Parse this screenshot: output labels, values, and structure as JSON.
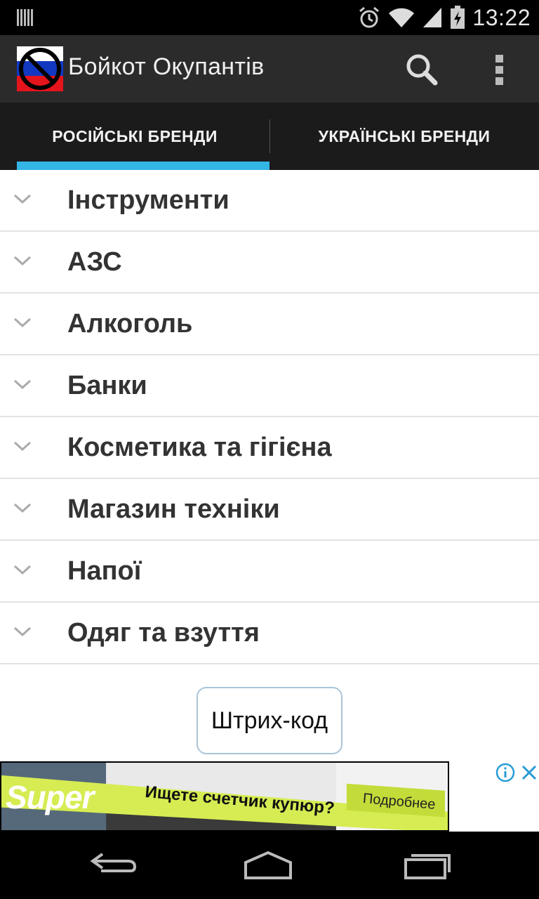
{
  "status_bar": {
    "time": "13:22",
    "icons": [
      "barcode-notification-icon",
      "alarm-icon",
      "wifi-icon",
      "signal-icon",
      "battery-charging-icon"
    ]
  },
  "action_bar": {
    "title": "Бойкот Окупантів",
    "logo": "ru-flag-prohibited-logo",
    "actions": [
      "search-icon",
      "overflow-menu-icon"
    ]
  },
  "tabs": [
    {
      "label": "РОСІЙСЬКІ БРЕНДИ",
      "selected": true
    },
    {
      "label": "УКРАЇНСЬКІ БРЕНДИ",
      "selected": false
    }
  ],
  "categories": [
    {
      "label": "Інструменти"
    },
    {
      "label": "АЗС"
    },
    {
      "label": "Алкоголь"
    },
    {
      "label": "Банки"
    },
    {
      "label": "Косметика та гігієна"
    },
    {
      "label": "Магазин техніки"
    },
    {
      "label": "Напої"
    },
    {
      "label": "Одяг та взуття"
    }
  ],
  "barcode_button": {
    "label": "Штрих-код"
  },
  "ad": {
    "brand": "Super",
    "headline": "Ищете счетчик купюр?",
    "cta": "Подробнее",
    "accent_color": "#d6ec52"
  },
  "nav_bar": [
    "back-icon",
    "home-icon",
    "recents-icon"
  ],
  "colors": {
    "accent": "#33b5e5",
    "action_bar": "#2b2b2b",
    "tab_bar": "#1b1b1b"
  }
}
